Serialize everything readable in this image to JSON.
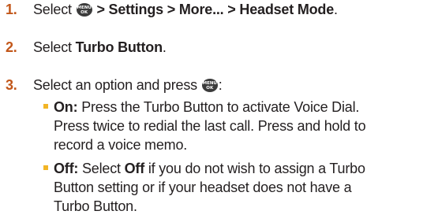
{
  "steps": [
    {
      "num": "1.",
      "pre": "Select ",
      "key": {
        "icon": "menu-ok-key-icon",
        "top": "MENU",
        "bottom": "OK"
      },
      "path": " > Settings > More... > Headset Mode",
      "post": "."
    },
    {
      "num": "2.",
      "pre": "Select ",
      "bold": "Turbo Button",
      "post": "."
    },
    {
      "num": "3.",
      "pre": "Select an option and press ",
      "key": {
        "icon": "menu-ok-key-icon",
        "top": "MENU",
        "bottom": "OK"
      },
      "post": ":"
    }
  ],
  "options": [
    {
      "label": "On:",
      "lines": [
        " Press the Turbo Button to activate Voice Dial.",
        "Press twice to redial the last call. Press and hold to",
        "record a voice memo."
      ]
    },
    {
      "label": "Off:",
      "line1_pre": " Select ",
      "line1_bold": "Off",
      "line1_post": " if you do not wish to assign a Turbo",
      "lines": [
        "Button setting or if your headset does not have a",
        "Turbo Button."
      ]
    }
  ],
  "colors": {
    "number": "#c2571a",
    "bullet": "#f2b526",
    "text": "#231f20"
  }
}
